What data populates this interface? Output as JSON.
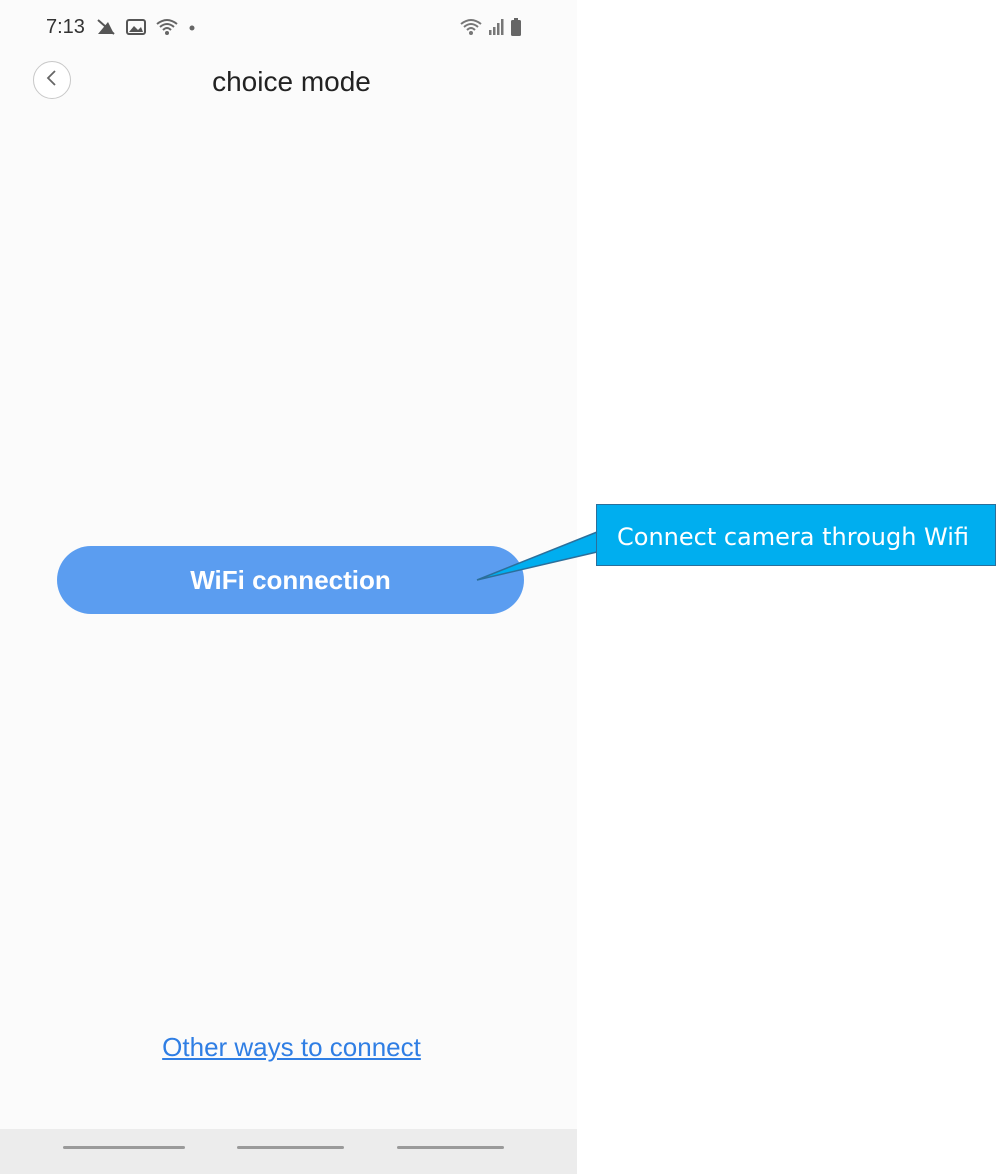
{
  "status_bar": {
    "time": "7:13",
    "left_icons": [
      "mute-notification-icon",
      "image-icon",
      "wifi-icon",
      "dot-icon"
    ],
    "right_icons": [
      "wifi-icon",
      "signal-icon",
      "battery-icon"
    ]
  },
  "header": {
    "back_icon": "chevron-left-icon",
    "title": "choice mode"
  },
  "main": {
    "wifi_button_label": "WiFi connection",
    "other_ways_link": "Other ways to connect"
  },
  "callout": {
    "text": "Connect camera through Wifi",
    "color": "#00aeef"
  },
  "colors": {
    "primary_button": "#5b9df0",
    "link": "#2f7ee4",
    "background": "#fbfbfb"
  }
}
